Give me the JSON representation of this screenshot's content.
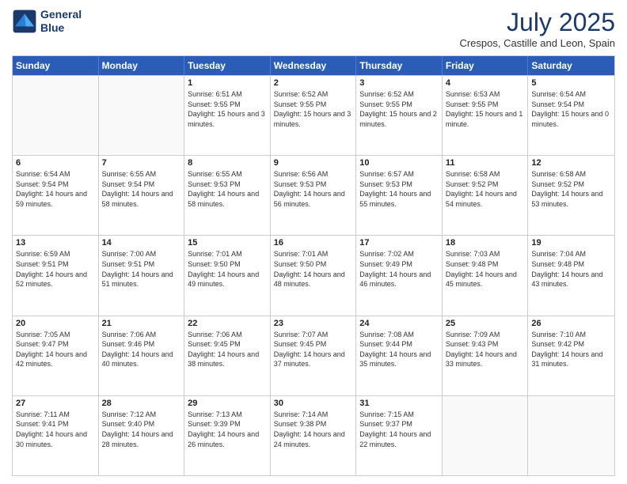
{
  "logo": {
    "line1": "General",
    "line2": "Blue"
  },
  "title": "July 2025",
  "subtitle": "Crespos, Castille and Leon, Spain",
  "header_days": [
    "Sunday",
    "Monday",
    "Tuesday",
    "Wednesday",
    "Thursday",
    "Friday",
    "Saturday"
  ],
  "weeks": [
    [
      {
        "day": "",
        "sunrise": "",
        "sunset": "",
        "daylight": ""
      },
      {
        "day": "",
        "sunrise": "",
        "sunset": "",
        "daylight": ""
      },
      {
        "day": "1",
        "sunrise": "Sunrise: 6:51 AM",
        "sunset": "Sunset: 9:55 PM",
        "daylight": "Daylight: 15 hours and 3 minutes."
      },
      {
        "day": "2",
        "sunrise": "Sunrise: 6:52 AM",
        "sunset": "Sunset: 9:55 PM",
        "daylight": "Daylight: 15 hours and 3 minutes."
      },
      {
        "day": "3",
        "sunrise": "Sunrise: 6:52 AM",
        "sunset": "Sunset: 9:55 PM",
        "daylight": "Daylight: 15 hours and 2 minutes."
      },
      {
        "day": "4",
        "sunrise": "Sunrise: 6:53 AM",
        "sunset": "Sunset: 9:55 PM",
        "daylight": "Daylight: 15 hours and 1 minute."
      },
      {
        "day": "5",
        "sunrise": "Sunrise: 6:54 AM",
        "sunset": "Sunset: 9:54 PM",
        "daylight": "Daylight: 15 hours and 0 minutes."
      }
    ],
    [
      {
        "day": "6",
        "sunrise": "Sunrise: 6:54 AM",
        "sunset": "Sunset: 9:54 PM",
        "daylight": "Daylight: 14 hours and 59 minutes."
      },
      {
        "day": "7",
        "sunrise": "Sunrise: 6:55 AM",
        "sunset": "Sunset: 9:54 PM",
        "daylight": "Daylight: 14 hours and 58 minutes."
      },
      {
        "day": "8",
        "sunrise": "Sunrise: 6:55 AM",
        "sunset": "Sunset: 9:53 PM",
        "daylight": "Daylight: 14 hours and 58 minutes."
      },
      {
        "day": "9",
        "sunrise": "Sunrise: 6:56 AM",
        "sunset": "Sunset: 9:53 PM",
        "daylight": "Daylight: 14 hours and 56 minutes."
      },
      {
        "day": "10",
        "sunrise": "Sunrise: 6:57 AM",
        "sunset": "Sunset: 9:53 PM",
        "daylight": "Daylight: 14 hours and 55 minutes."
      },
      {
        "day": "11",
        "sunrise": "Sunrise: 6:58 AM",
        "sunset": "Sunset: 9:52 PM",
        "daylight": "Daylight: 14 hours and 54 minutes."
      },
      {
        "day": "12",
        "sunrise": "Sunrise: 6:58 AM",
        "sunset": "Sunset: 9:52 PM",
        "daylight": "Daylight: 14 hours and 53 minutes."
      }
    ],
    [
      {
        "day": "13",
        "sunrise": "Sunrise: 6:59 AM",
        "sunset": "Sunset: 9:51 PM",
        "daylight": "Daylight: 14 hours and 52 minutes."
      },
      {
        "day": "14",
        "sunrise": "Sunrise: 7:00 AM",
        "sunset": "Sunset: 9:51 PM",
        "daylight": "Daylight: 14 hours and 51 minutes."
      },
      {
        "day": "15",
        "sunrise": "Sunrise: 7:01 AM",
        "sunset": "Sunset: 9:50 PM",
        "daylight": "Daylight: 14 hours and 49 minutes."
      },
      {
        "day": "16",
        "sunrise": "Sunrise: 7:01 AM",
        "sunset": "Sunset: 9:50 PM",
        "daylight": "Daylight: 14 hours and 48 minutes."
      },
      {
        "day": "17",
        "sunrise": "Sunrise: 7:02 AM",
        "sunset": "Sunset: 9:49 PM",
        "daylight": "Daylight: 14 hours and 46 minutes."
      },
      {
        "day": "18",
        "sunrise": "Sunrise: 7:03 AM",
        "sunset": "Sunset: 9:48 PM",
        "daylight": "Daylight: 14 hours and 45 minutes."
      },
      {
        "day": "19",
        "sunrise": "Sunrise: 7:04 AM",
        "sunset": "Sunset: 9:48 PM",
        "daylight": "Daylight: 14 hours and 43 minutes."
      }
    ],
    [
      {
        "day": "20",
        "sunrise": "Sunrise: 7:05 AM",
        "sunset": "Sunset: 9:47 PM",
        "daylight": "Daylight: 14 hours and 42 minutes."
      },
      {
        "day": "21",
        "sunrise": "Sunrise: 7:06 AM",
        "sunset": "Sunset: 9:46 PM",
        "daylight": "Daylight: 14 hours and 40 minutes."
      },
      {
        "day": "22",
        "sunrise": "Sunrise: 7:06 AM",
        "sunset": "Sunset: 9:45 PM",
        "daylight": "Daylight: 14 hours and 38 minutes."
      },
      {
        "day": "23",
        "sunrise": "Sunrise: 7:07 AM",
        "sunset": "Sunset: 9:45 PM",
        "daylight": "Daylight: 14 hours and 37 minutes."
      },
      {
        "day": "24",
        "sunrise": "Sunrise: 7:08 AM",
        "sunset": "Sunset: 9:44 PM",
        "daylight": "Daylight: 14 hours and 35 minutes."
      },
      {
        "day": "25",
        "sunrise": "Sunrise: 7:09 AM",
        "sunset": "Sunset: 9:43 PM",
        "daylight": "Daylight: 14 hours and 33 minutes."
      },
      {
        "day": "26",
        "sunrise": "Sunrise: 7:10 AM",
        "sunset": "Sunset: 9:42 PM",
        "daylight": "Daylight: 14 hours and 31 minutes."
      }
    ],
    [
      {
        "day": "27",
        "sunrise": "Sunrise: 7:11 AM",
        "sunset": "Sunset: 9:41 PM",
        "daylight": "Daylight: 14 hours and 30 minutes."
      },
      {
        "day": "28",
        "sunrise": "Sunrise: 7:12 AM",
        "sunset": "Sunset: 9:40 PM",
        "daylight": "Daylight: 14 hours and 28 minutes."
      },
      {
        "day": "29",
        "sunrise": "Sunrise: 7:13 AM",
        "sunset": "Sunset: 9:39 PM",
        "daylight": "Daylight: 14 hours and 26 minutes."
      },
      {
        "day": "30",
        "sunrise": "Sunrise: 7:14 AM",
        "sunset": "Sunset: 9:38 PM",
        "daylight": "Daylight: 14 hours and 24 minutes."
      },
      {
        "day": "31",
        "sunrise": "Sunrise: 7:15 AM",
        "sunset": "Sunset: 9:37 PM",
        "daylight": "Daylight: 14 hours and 22 minutes."
      },
      {
        "day": "",
        "sunrise": "",
        "sunset": "",
        "daylight": ""
      },
      {
        "day": "",
        "sunrise": "",
        "sunset": "",
        "daylight": ""
      }
    ]
  ]
}
